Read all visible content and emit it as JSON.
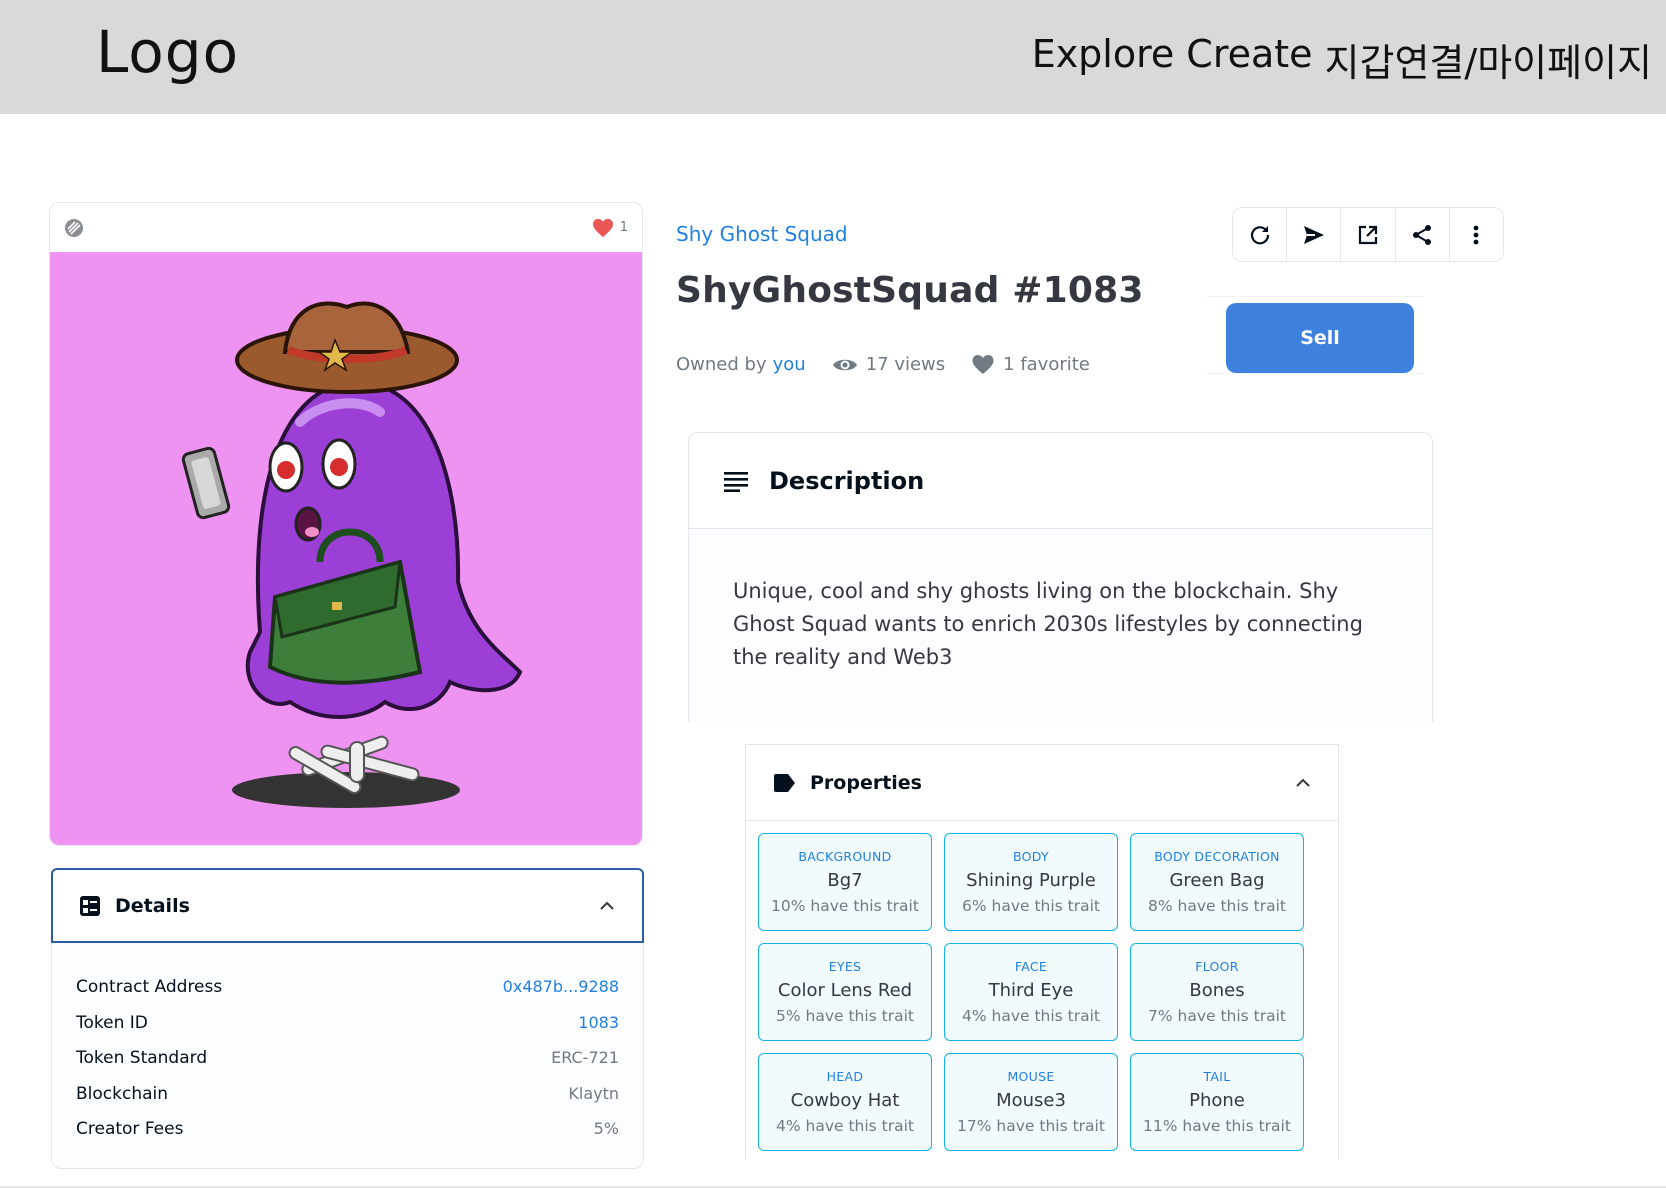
{
  "header": {
    "logo": "Logo",
    "nav": [
      "Explore",
      "Create",
      "지갑연결/마이페이지"
    ]
  },
  "image_card": {
    "favorite_count": "1"
  },
  "details": {
    "title": "Details",
    "rows": [
      {
        "label": "Contract Address",
        "value": "0x487b...9288"
      },
      {
        "label": "Token ID",
        "value": "1083"
      },
      {
        "label": "Token Standard",
        "value": "ERC-721"
      },
      {
        "label": "Blockchain",
        "value": "Klaytn"
      },
      {
        "label": "Creator Fees",
        "value": "5%"
      }
    ]
  },
  "item": {
    "collection": "Shy Ghost Squad",
    "title": "ShyGhostSquad #1083",
    "owned_by": "Owned by",
    "owner": "you",
    "views": "17 views",
    "favorites": "1 favorite",
    "sell_label": "Sell"
  },
  "toolbar": [
    "refresh-icon",
    "send-icon",
    "external-link-icon",
    "share-icon",
    "more-icon"
  ],
  "description": {
    "title": "Description",
    "text": "Unique, cool and shy ghosts living on the blockchain. Shy Ghost Squad wants to enrich 2030s lifestyles by connecting the reality and Web3"
  },
  "properties": {
    "title": "Properties",
    "traits": [
      {
        "type": "Background",
        "value": "Bg7",
        "rarity": "10% have this trait"
      },
      {
        "type": "Body",
        "value": "Shining Purple",
        "rarity": "6% have this trait"
      },
      {
        "type": "Body Decoration",
        "value": "Green Bag",
        "rarity": "8% have this trait"
      },
      {
        "type": "Eyes",
        "value": "Color Lens Red",
        "rarity": "5% have this trait"
      },
      {
        "type": "Face",
        "value": "Third Eye",
        "rarity": "4% have this trait"
      },
      {
        "type": "Floor",
        "value": "Bones",
        "rarity": "7% have this trait"
      },
      {
        "type": "Head",
        "value": "Cowboy Hat",
        "rarity": "4% have this trait"
      },
      {
        "type": "Mouse",
        "value": "Mouse3",
        "rarity": "17% have this trait"
      },
      {
        "type": "Tail",
        "value": "Phone",
        "rarity": "11% have this trait"
      }
    ]
  },
  "colors": {
    "accent": "#2081e2",
    "sell": "#3f81de",
    "art_bg": "#ef93f2",
    "trait_border": "#15b2e5"
  }
}
